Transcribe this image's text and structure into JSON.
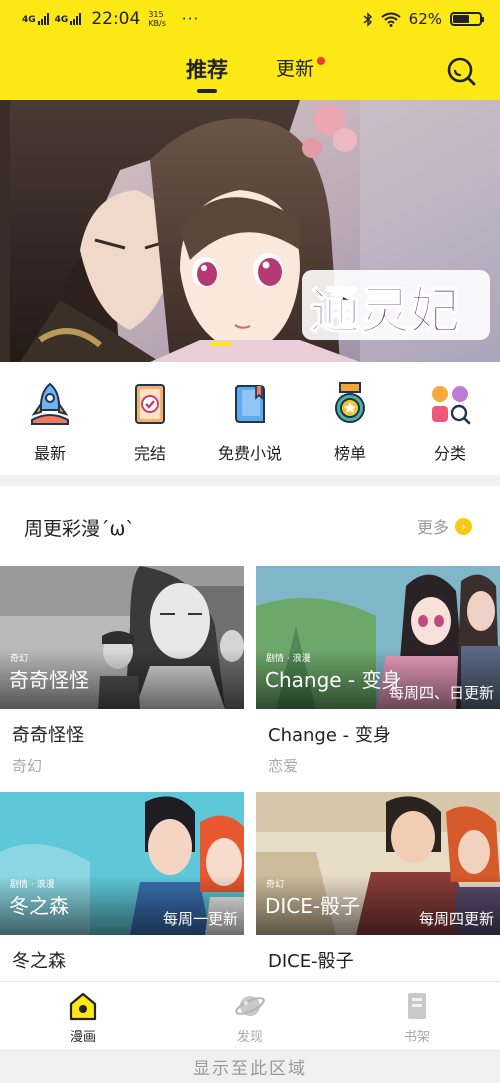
{
  "status": {
    "net1": "4G",
    "net2": "4G",
    "time": "22:04",
    "speed_value": "315",
    "speed_unit": "KB/s",
    "dots": "···",
    "battery": "62%",
    "battery_level": 0.62
  },
  "header": {
    "tab_recommend": "推荐",
    "tab_update": "更新"
  },
  "banner": {
    "logo_text": "通灵妃",
    "indicator_count": 1
  },
  "categories": [
    {
      "label": "最新",
      "icon": "rocket-icon"
    },
    {
      "label": "完结",
      "icon": "finished-book-icon"
    },
    {
      "label": "免费小说",
      "icon": "novel-book-icon"
    },
    {
      "label": "榜单",
      "icon": "medal-icon"
    },
    {
      "label": "分类",
      "icon": "category-grid-icon"
    }
  ],
  "weekly": {
    "title": "周更彩漫´ω`",
    "more": "更多",
    "cards": [
      {
        "title": "奇奇怪怪",
        "genre": "奇幻",
        "img_genre": "奇幻",
        "img_name": "奇奇怪怪",
        "schedule": ""
      },
      {
        "title": "Change - 变身",
        "genre": "恋爱",
        "img_genre": "剧情 · 浪漫",
        "img_name": "Change - 变身",
        "schedule": "每周四、日更新"
      },
      {
        "title": "冬之森",
        "genre": "",
        "img_genre": "剧情 · 浪漫",
        "img_name": "冬之森",
        "schedule": "每周一更新"
      },
      {
        "title": "DICE-骰子",
        "genre": "",
        "img_genre": "奇幻",
        "img_name": "DICE-骰子",
        "schedule": "每周四更新"
      }
    ]
  },
  "bottom_nav": [
    {
      "label": "漫画",
      "active": true
    },
    {
      "label": "发现",
      "active": false
    },
    {
      "label": "书架",
      "active": false
    }
  ],
  "footer": "显示至此区域",
  "colors": {
    "accent": "#fbe814",
    "red_dot": "#f03a2e",
    "more_badge": "#fbc814"
  }
}
